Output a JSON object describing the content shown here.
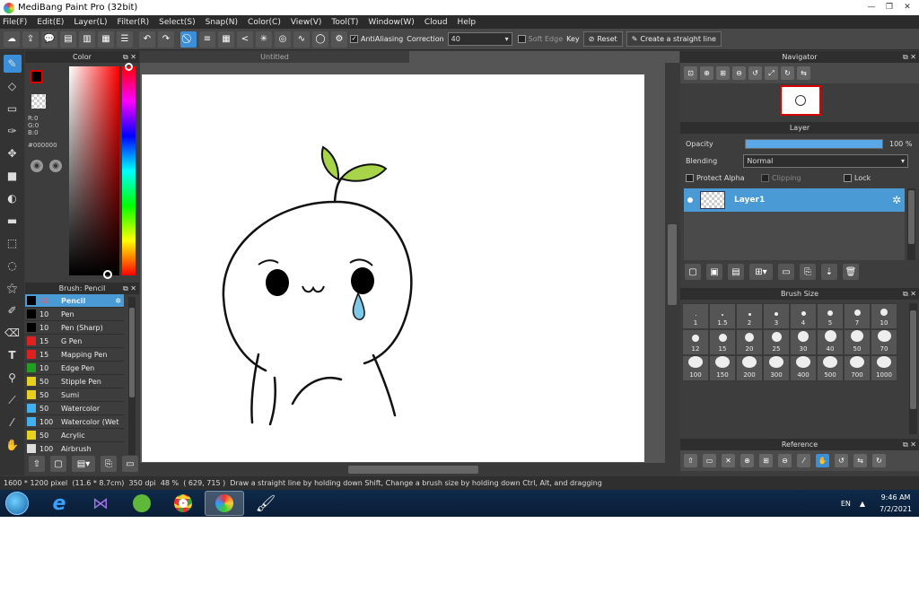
{
  "window": {
    "title": "MediBang Paint Pro (32bit)"
  },
  "menu": [
    "File(F)",
    "Edit(E)",
    "Layer(L)",
    "Filter(R)",
    "Select(S)",
    "Snap(N)",
    "Color(C)",
    "View(V)",
    "Tool(T)",
    "Window(W)",
    "Cloud",
    "Help"
  ],
  "toolbar": {
    "antialiasing_label": "AntiAliasing",
    "correction_label": "Correction",
    "correction_value": "40",
    "soft_edge_label": "Soft Edge",
    "key_label": "Key",
    "reset_label": "Reset",
    "straight_line_label": "Create a straight line"
  },
  "color_panel": {
    "title": "Color",
    "r": "R:0",
    "g": "G:0",
    "b": "B:0",
    "hex": "#000000",
    "current_color": "#000000"
  },
  "brush_panel": {
    "title": "Brush: Pencil",
    "items": [
      {
        "size": "40",
        "name": "Pencil",
        "color": "#000000"
      },
      {
        "size": "10",
        "name": "Pen",
        "color": "#000000"
      },
      {
        "size": "10",
        "name": "Pen (Sharp)",
        "color": "#000000"
      },
      {
        "size": "15",
        "name": "G Pen",
        "color": "#e02020"
      },
      {
        "size": "15",
        "name": "Mapping Pen",
        "color": "#e02020"
      },
      {
        "size": "10",
        "name": "Edge Pen",
        "color": "#20a020"
      },
      {
        "size": "50",
        "name": "Stipple Pen",
        "color": "#e8d020"
      },
      {
        "size": "50",
        "name": "Sumi",
        "color": "#e8d020"
      },
      {
        "size": "50",
        "name": "Watercolor",
        "color": "#40b0f0"
      },
      {
        "size": "100",
        "name": "Watercolor (Wet",
        "color": "#40b0f0"
      },
      {
        "size": "50",
        "name": "Acrylic",
        "color": "#e8d020"
      },
      {
        "size": "100",
        "name": "Airbrush",
        "color": "#dddddd"
      }
    ]
  },
  "document": {
    "tab": "Untitled"
  },
  "navigator": {
    "title": "Navigator"
  },
  "layer_panel": {
    "title": "Layer",
    "opacity_label": "Opacity",
    "opacity_value": "100 %",
    "opacity_fraction": 1.0,
    "blending_label": "Blending",
    "blending_value": "Normal",
    "protect_alpha": "Protect Alpha",
    "clipping": "Clipping",
    "lock": "Lock",
    "layer_name": "Layer1"
  },
  "brush_size": {
    "title": "Brush Size",
    "sizes": [
      "1",
      "1.5",
      "2",
      "3",
      "4",
      "5",
      "7",
      "10",
      "12",
      "15",
      "20",
      "25",
      "30",
      "40",
      "50",
      "70",
      "100",
      "150",
      "200",
      "300",
      "400",
      "500",
      "700",
      "1000"
    ]
  },
  "reference": {
    "title": "Reference"
  },
  "status": {
    "size": "1600 * 1200 pixel",
    "cm": "(11.6 * 8.7cm)",
    "dpi": "350 dpi",
    "zoom": "48 %",
    "coords": "( 629, 715 )",
    "hint": "Draw a straight line by holding down Shift, Change a brush size by holding down Ctrl, Alt, and dragging"
  },
  "taskbar": {
    "lang": "EN",
    "time": "9:46 AM",
    "date": "7/2/2021"
  }
}
